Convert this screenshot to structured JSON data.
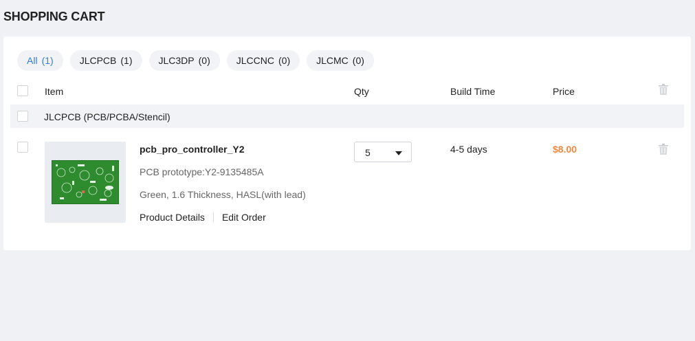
{
  "page": {
    "title": "SHOPPING CART"
  },
  "tabs": [
    {
      "label": "All",
      "count": "(1)",
      "active": true
    },
    {
      "label": "JLCPCB",
      "count": "(1)"
    },
    {
      "label": "JLC3DP",
      "count": "(0)"
    },
    {
      "label": "JLCCNC",
      "count": "(0)"
    },
    {
      "label": "JLCMC",
      "count": "(0)"
    }
  ],
  "table": {
    "headers": {
      "item": "Item",
      "qty": "Qty",
      "build_time": "Build Time",
      "price": "Price"
    }
  },
  "group": {
    "label": "JLCPCB (PCB/PCBA/Stencil)"
  },
  "item": {
    "name": "pcb_pro_controller_Y2",
    "subtitle": "PCB prototype:Y2-9135485A",
    "spec": "Green, 1.6 Thickness, HASL(with lead)",
    "links": {
      "details": "Product Details",
      "edit": "Edit Order"
    },
    "qty": "5",
    "build_time": "4-5 days",
    "price": "$8.00"
  },
  "colors": {
    "accent": "#2f7fe0",
    "price": "#f5863c",
    "pcb_green": "#2e8b2e"
  },
  "icons": {
    "delete": "trash-icon",
    "dropdown": "caret-down-icon"
  }
}
